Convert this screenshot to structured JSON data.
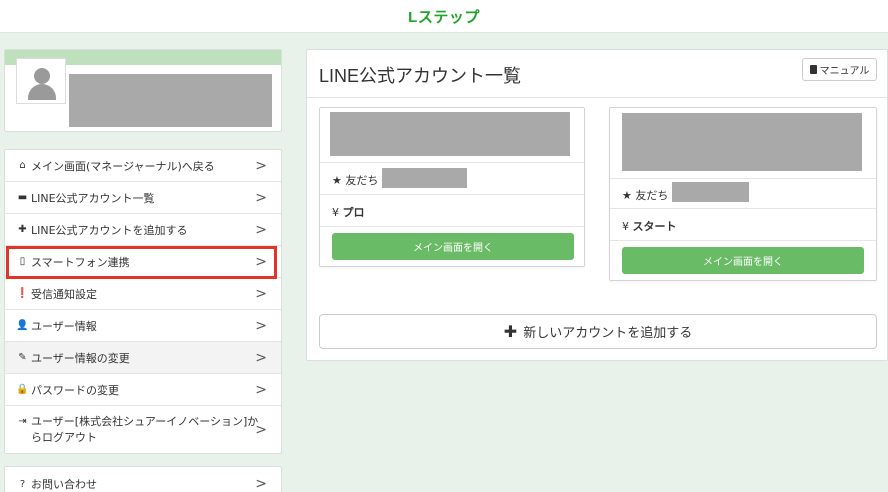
{
  "header": {
    "brand": "Lステップ"
  },
  "sidebar": {
    "items": [
      {
        "icon": "home-icon",
        "glyph": "⌂",
        "label": "メイン画面(マネージャーナル)へ戻る"
      },
      {
        "icon": "comment-icon",
        "glyph": "▬",
        "label": "LINE公式アカウント一覧"
      },
      {
        "icon": "plus-icon",
        "glyph": "✚",
        "label": "LINE公式アカウントを追加する"
      },
      {
        "icon": "phone-icon",
        "glyph": "▯",
        "label": "スマートフォン連携"
      },
      {
        "icon": "alert-icon",
        "glyph": "❗",
        "label": "受信通知設定"
      },
      {
        "icon": "user-icon",
        "glyph": "👤",
        "label": "ユーザー情報"
      },
      {
        "icon": "pencil-icon",
        "glyph": "✎",
        "label": "ユーザー情報の変更"
      },
      {
        "icon": "lock-icon",
        "glyph": "🔒",
        "label": "パスワードの変更"
      },
      {
        "icon": "logout-icon",
        "glyph": "⇥",
        "label": "ユーザー[株式会社シュアーイノベーション]からログアウト"
      }
    ],
    "support": {
      "icon": "help-icon",
      "glyph": "?",
      "label": "お問い合わせ"
    },
    "chevron": ">"
  },
  "main": {
    "title": "LINE公式アカウント一覧",
    "manual_label": "マニュアル",
    "friends_label": "★ 友だち",
    "plan_icon": "¥",
    "accounts": [
      {
        "plan": "プロ",
        "open_label": "メイン画面を開く"
      },
      {
        "plan": "スタート",
        "open_label": "メイン画面を開く"
      }
    ],
    "add_account_label": "新しいアカウントを追加する",
    "add_icon": "✚"
  },
  "colors": {
    "brand": "#1fa328",
    "background": "#e9f2ea",
    "button_green": "#6abb66",
    "highlight": "#e0362a",
    "redaction": "#a9a9a9"
  }
}
